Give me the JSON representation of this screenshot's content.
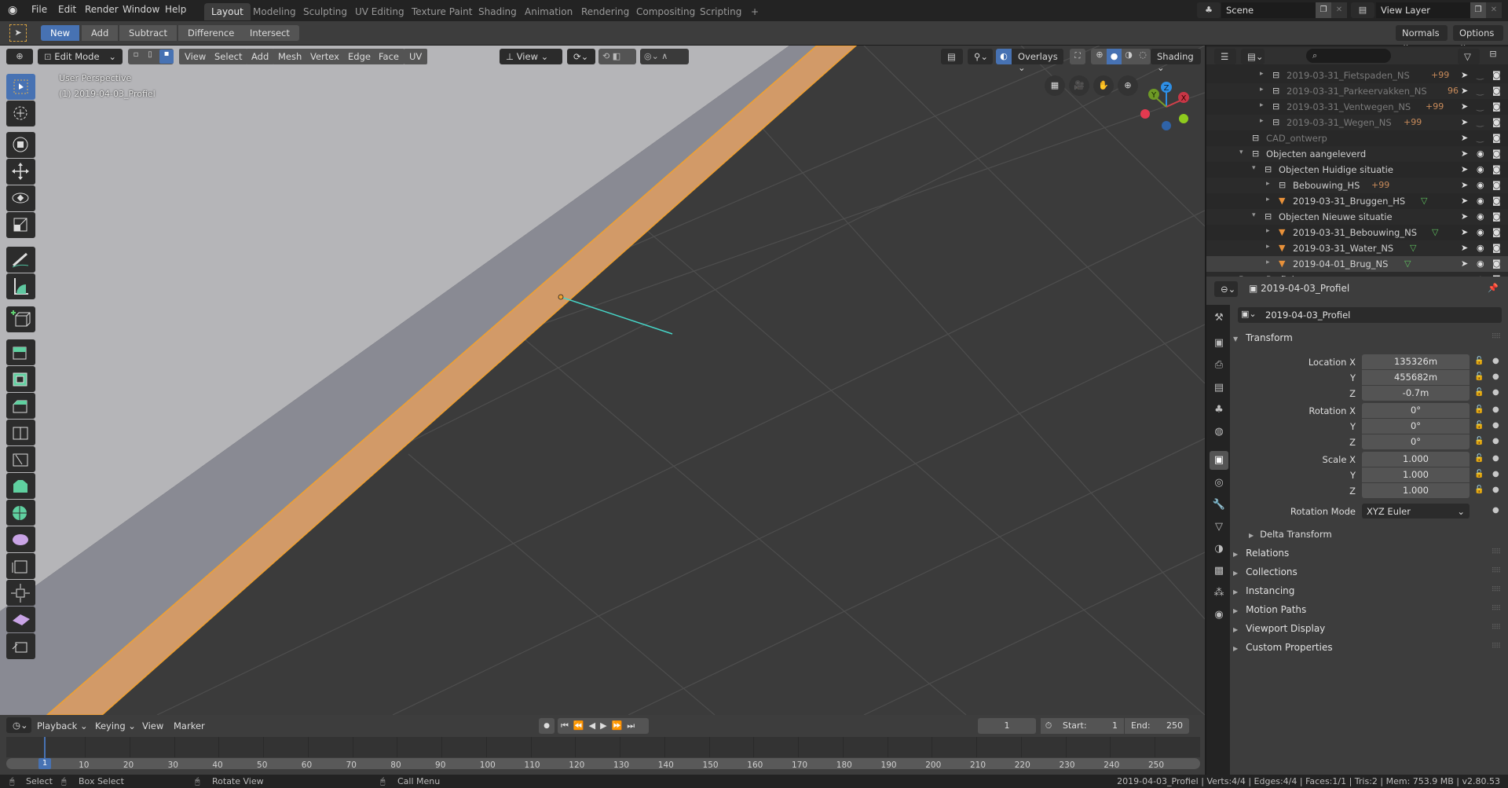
{
  "app": {
    "name": "Blender",
    "version": "v2.80.53"
  },
  "menu": [
    "File",
    "Edit",
    "Render",
    "Window",
    "Help"
  ],
  "workspaces": [
    {
      "label": "Layout",
      "active": true
    },
    {
      "label": "Modeling"
    },
    {
      "label": "Sculpting"
    },
    {
      "label": "UV Editing"
    },
    {
      "label": "Texture Paint"
    },
    {
      "label": "Shading"
    },
    {
      "label": "Animation"
    },
    {
      "label": "Rendering"
    },
    {
      "label": "Compositing"
    },
    {
      "label": "Scripting"
    }
  ],
  "add_workspace": "+",
  "scene": {
    "name": "Scene",
    "view_layer": "View Layer"
  },
  "tool_header": {
    "modes": [
      {
        "label": "New",
        "active": true
      },
      {
        "label": "Add"
      },
      {
        "label": "Subtract"
      },
      {
        "label": "Difference"
      },
      {
        "label": "Intersect"
      }
    ],
    "normals": "Normals",
    "options": "Options"
  },
  "viewport": {
    "mode": "Edit Mode",
    "menus": [
      "View",
      "Select",
      "Add",
      "Mesh",
      "Vertex",
      "Edge",
      "Face",
      "UV"
    ],
    "orientation": "View",
    "overlays": "Overlays",
    "shading": "Shading",
    "info_line1": "User Perspective",
    "info_line2": "(1) 2019-04-03_Profiel",
    "gizmo_axes": [
      "X",
      "Y",
      "Z"
    ],
    "colors": {
      "background": "#3b3b3b",
      "mesh": "#d19a68",
      "mesh_edge": "#f0a030",
      "floor": "#b3b3b6",
      "wall": "#8a8b94",
      "grid": "#555555",
      "normal_line": "#46d6c8"
    }
  },
  "outliner": {
    "rows": [
      {
        "label": "2019-03-31_Fietspaden_NS",
        "badge": "+99",
        "dim": true,
        "visible": false
      },
      {
        "label": "2019-03-31_Parkeervakken_NS",
        "badge": "96",
        "dim": true,
        "visible": false
      },
      {
        "label": "2019-03-31_Ventwegen_NS",
        "badge": "+99",
        "dim": true,
        "visible": false
      },
      {
        "label": "2019-03-31_Wegen_NS",
        "badge": "+99",
        "dim": true,
        "visible": false
      },
      {
        "label": "CAD_ontwerp",
        "dim": true,
        "visible": false
      },
      {
        "label": "Objecten aangeleverd",
        "visible": true
      },
      {
        "label": "Objecten Huidige situatie",
        "visible": true
      },
      {
        "label": "Bebouwing_HS",
        "badge": "+99",
        "visible": true
      },
      {
        "label": "2019-03-31_Bruggen_HS",
        "visible": true
      },
      {
        "label": "Objecten Nieuwe situatie",
        "visible": true
      },
      {
        "label": "2019-03-31_Bebouwing_NS",
        "visible": true
      },
      {
        "label": "2019-03-31_Water_NS",
        "visible": true
      },
      {
        "label": "2019-04-01_Brug_NS",
        "visible": true,
        "selected": true
      },
      {
        "label": "Profiel",
        "visible": true
      }
    ]
  },
  "properties": {
    "context": "2019-04-03_Profiel",
    "object_name": "2019-04-03_Profiel",
    "transform": {
      "title": "Transform",
      "location": {
        "label": "Location X",
        "x": "135326m",
        "y": "455682m",
        "z": "-0.7m"
      },
      "rotation": {
        "label": "Rotation X",
        "x": "0°",
        "y": "0°",
        "z": "0°"
      },
      "scale": {
        "label": "Scale X",
        "x": "1.000",
        "y": "1.000",
        "z": "1.000"
      },
      "axis_y": "Y",
      "axis_z": "Z",
      "rotation_mode_label": "Rotation Mode",
      "rotation_mode": "XYZ Euler",
      "delta": "Delta Transform"
    },
    "panels": [
      "Relations",
      "Collections",
      "Instancing",
      "Motion Paths",
      "Viewport Display",
      "Custom Properties"
    ]
  },
  "timeline": {
    "menus": [
      "Playback",
      "Keying",
      "View",
      "Marker"
    ],
    "current_frame": "1",
    "start_label": "Start:",
    "start": "1",
    "end_label": "End:",
    "end": "250",
    "ticks": [
      "10",
      "20",
      "30",
      "40",
      "50",
      "60",
      "70",
      "80",
      "90",
      "100",
      "110",
      "120",
      "130",
      "140",
      "150",
      "160",
      "170",
      "180",
      "190",
      "200",
      "210",
      "220",
      "230",
      "240",
      "250"
    ],
    "playhead": "1"
  },
  "statusbar": {
    "hints": [
      "Select",
      "Box Select",
      "Rotate View",
      "Call Menu"
    ],
    "info": "2019-04-03_Profiel | Verts:4/4 | Edges:4/4 | Faces:1/1 | Tris:2 | Mem: 753.9 MB | v2.80.53"
  }
}
